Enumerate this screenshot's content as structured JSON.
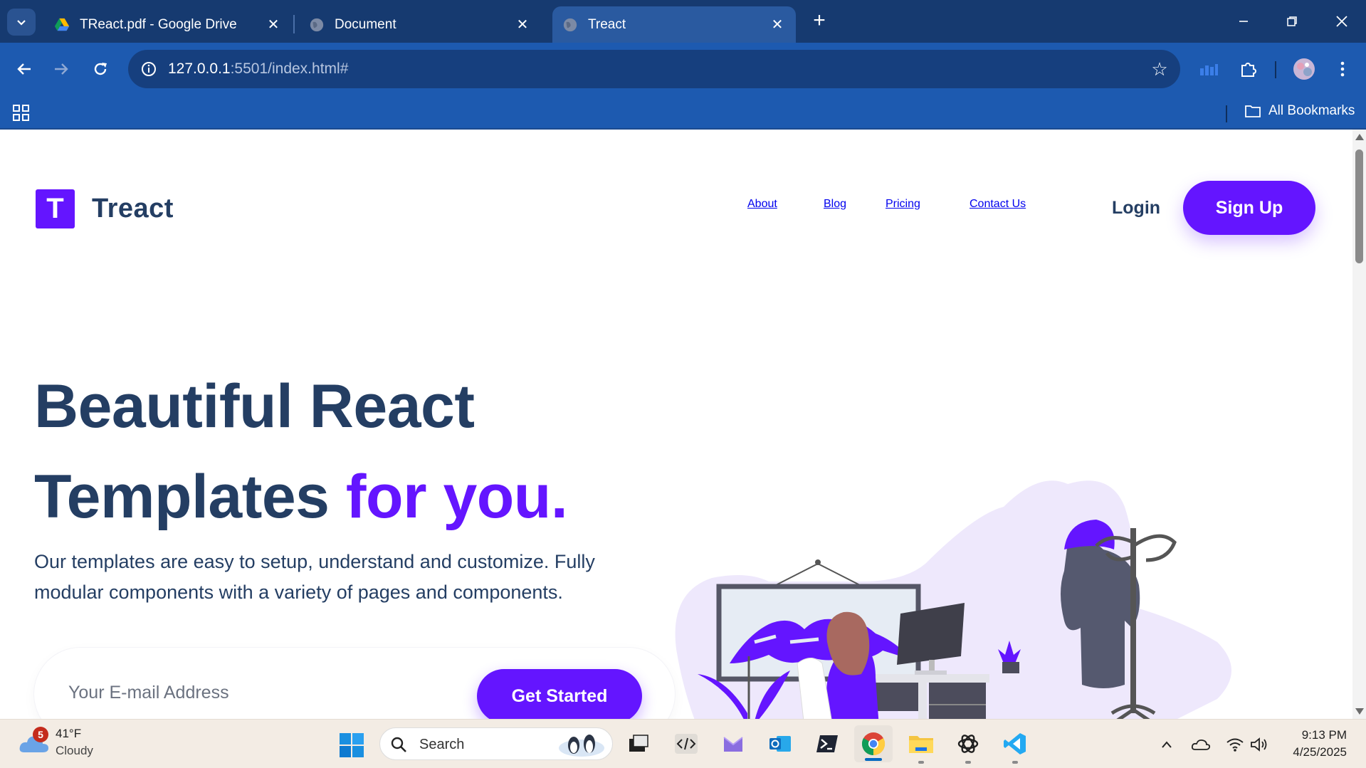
{
  "browser": {
    "tabs": [
      {
        "title": "TReact.pdf - Google Drive",
        "favicon": "google-drive-icon",
        "active": false
      },
      {
        "title": "Document",
        "favicon": "globe-icon",
        "active": false
      },
      {
        "title": "Treact",
        "favicon": "globe-icon",
        "active": true
      }
    ],
    "url_host": "127.0.0.1",
    "url_rest": ":5501/index.html#",
    "bookmarks_label": "All Bookmarks"
  },
  "site": {
    "logo_letter": "T",
    "logo_text": "Treact",
    "nav": [
      "About",
      "Blog",
      "Pricing",
      "Contact Us"
    ],
    "login": "Login",
    "signup": "Sign Up",
    "hero": {
      "line1": "Beautiful React",
      "line2_main": "Templates ",
      "line2_accent": "for you.",
      "description": "Our templates are easy to setup, understand and customize. Fully modular components with a variety of pages and components.",
      "email_placeholder": "Your E-mail Address",
      "cta": "Get Started"
    },
    "colors": {
      "primary": "#6415ff",
      "heading": "#243e63",
      "illustration_bg": "#eee8fc"
    }
  },
  "taskbar": {
    "weather_temp": "41°F",
    "weather_cond": "Cloudy",
    "weather_badge": "5",
    "search_label": "Search",
    "time": "9:13 PM",
    "date": "4/25/2025"
  }
}
